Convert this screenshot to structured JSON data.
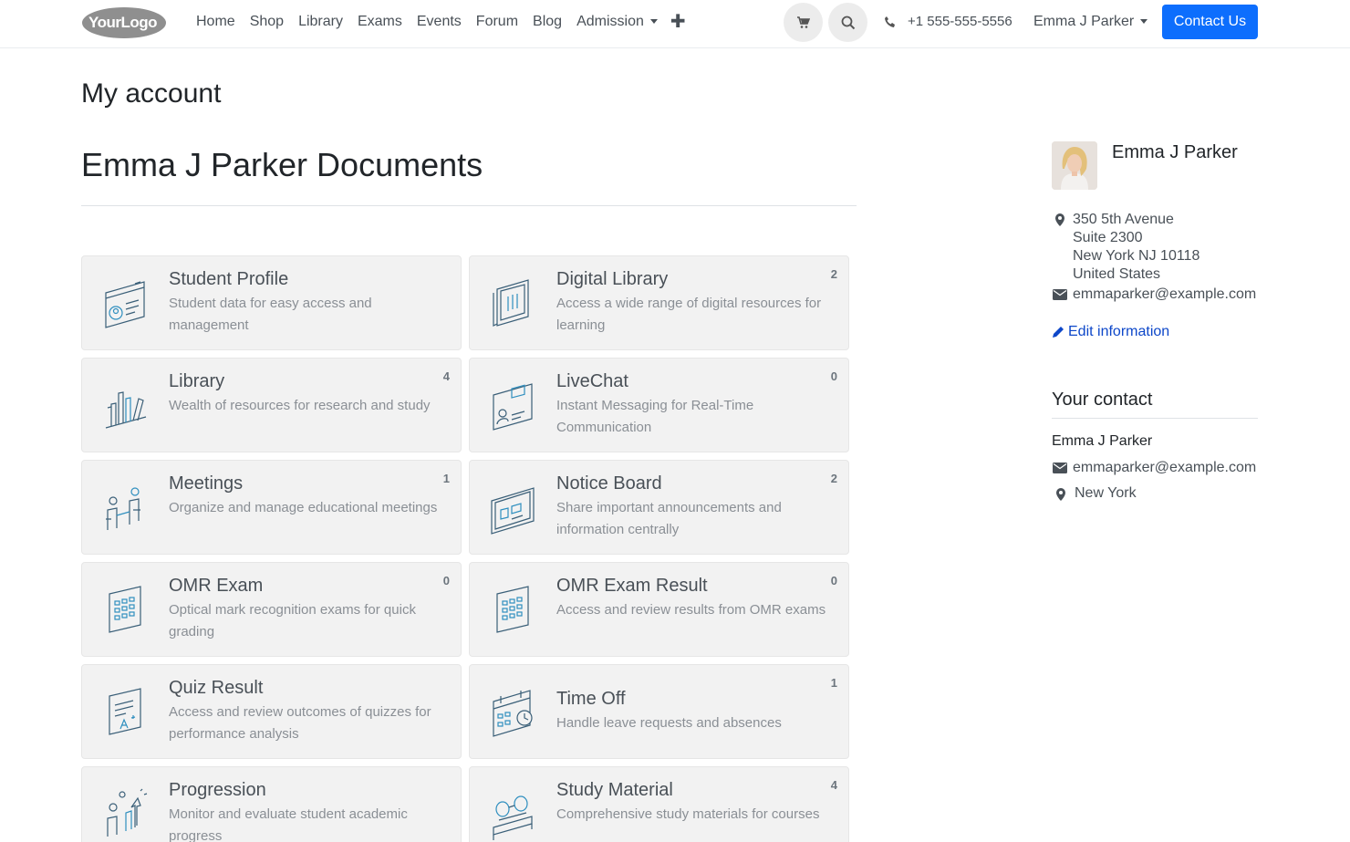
{
  "header": {
    "logo_text": "YourLogo",
    "nav": [
      "Home",
      "Shop",
      "Library",
      "Exams",
      "Events",
      "Forum",
      "Blog",
      "Admission"
    ],
    "phone": "+1 555-555-5556",
    "user": "Emma J Parker",
    "contact_button": "Contact Us",
    "icons": {
      "cart": "cart-icon",
      "search": "search-icon",
      "phone": "phone-icon",
      "add": "plus-icon"
    }
  },
  "main": {
    "page_title": "My account",
    "section_title": "Emma J Parker Documents"
  },
  "cards": [
    {
      "title": "Student Profile",
      "desc": "Student data for easy access and management",
      "count": "",
      "icon": "student-profile-icon"
    },
    {
      "title": "Digital Library",
      "desc": "Access a wide range of digital resources for learning",
      "count": "2",
      "icon": "digital-library-icon"
    },
    {
      "title": "Library",
      "desc": "Wealth of resources for research and study",
      "count": "4",
      "icon": "library-icon"
    },
    {
      "title": "LiveChat",
      "desc": "Instant Messaging for Real-Time Communication",
      "count": "0",
      "icon": "livechat-icon"
    },
    {
      "title": "Meetings",
      "desc": "Organize and manage educational meetings",
      "count": "1",
      "icon": "meetings-icon"
    },
    {
      "title": "Notice Board",
      "desc": "Share important announcements and information centrally",
      "count": "2",
      "icon": "notice-board-icon"
    },
    {
      "title": "OMR Exam",
      "desc": "Optical mark recognition exams for quick grading",
      "count": "0",
      "icon": "omr-exam-icon"
    },
    {
      "title": "OMR Exam Result",
      "desc": "Access and review results from OMR exams",
      "count": "0",
      "icon": "omr-result-icon"
    },
    {
      "title": "Quiz Result",
      "desc": "Access and review outcomes of quizzes for performance analysis",
      "count": "",
      "icon": "quiz-result-icon"
    },
    {
      "title": "Time Off",
      "desc": "Handle leave requests and absences",
      "count": "1",
      "icon": "time-off-icon"
    },
    {
      "title": "Progression",
      "desc": "Monitor and evaluate student academic progress",
      "count": "",
      "icon": "progression-icon"
    },
    {
      "title": "Study Material",
      "desc": "Comprehensive study materials for courses",
      "count": "4",
      "icon": "study-material-icon"
    }
  ],
  "sidebar": {
    "name": "Emma J Parker",
    "address": [
      "350 5th Avenue",
      "Suite 2300",
      "New York NJ 10118",
      "United States"
    ],
    "email": "emmaparker@example.com",
    "edit_label": "Edit information",
    "contact_heading": "Your contact",
    "contact_name": "Emma J Parker",
    "contact_email": "emmaparker@example.com",
    "contact_city": "New York"
  },
  "colors": {
    "accent": "#0d6efd",
    "link": "#0d47c9",
    "card_bg": "#f2f2f2",
    "icon_stroke": "#3a6a86"
  }
}
